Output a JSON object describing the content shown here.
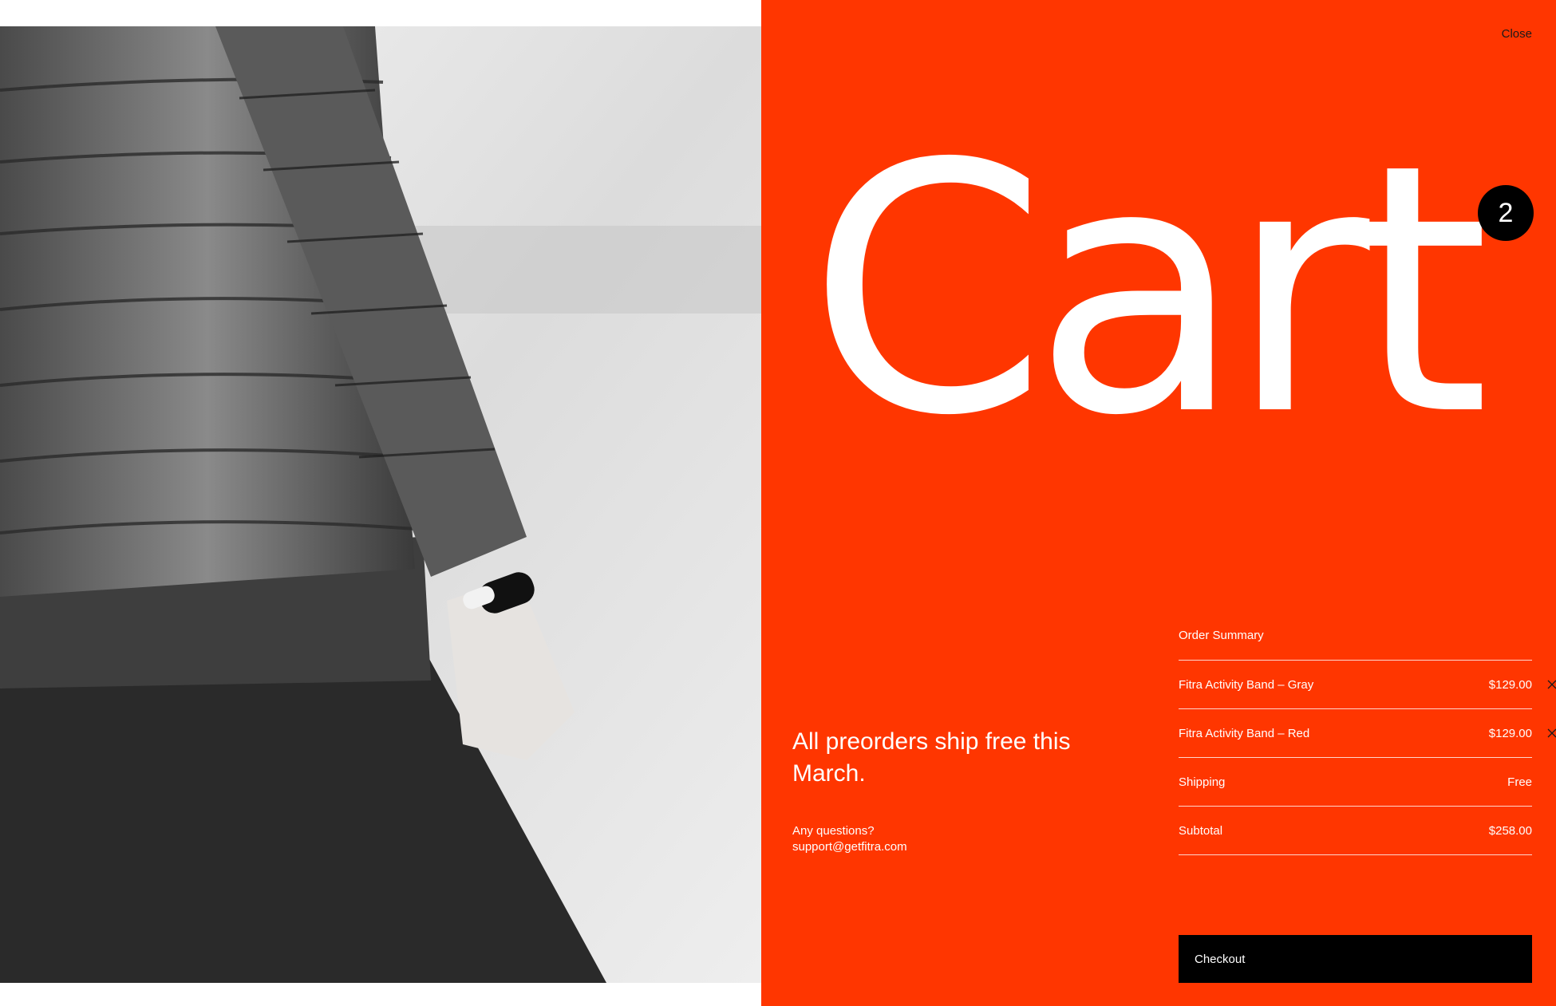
{
  "cart": {
    "close_label": "Close",
    "title": "Cart",
    "item_count": "2",
    "promo_text": "All preorders ship free this March.",
    "questions_label": "Any questions?",
    "support_email": "support@getfitra.com",
    "summary_title": "Order Summary",
    "items": [
      {
        "name": "Fitra Activity Band – Gray",
        "price": "$129.00",
        "remove_icon": "close-icon"
      },
      {
        "name": "Fitra Activity Band – Red",
        "price": "$129.00",
        "remove_icon": "close-icon"
      }
    ],
    "shipping_label": "Shipping",
    "shipping_value": "Free",
    "subtotal_label": "Subtotal",
    "subtotal_value": "$258.00",
    "checkout_label": "Checkout"
  },
  "colors": {
    "panel_bg": "#ff3600",
    "badge_bg": "#000000",
    "checkout_bg": "#000000"
  }
}
